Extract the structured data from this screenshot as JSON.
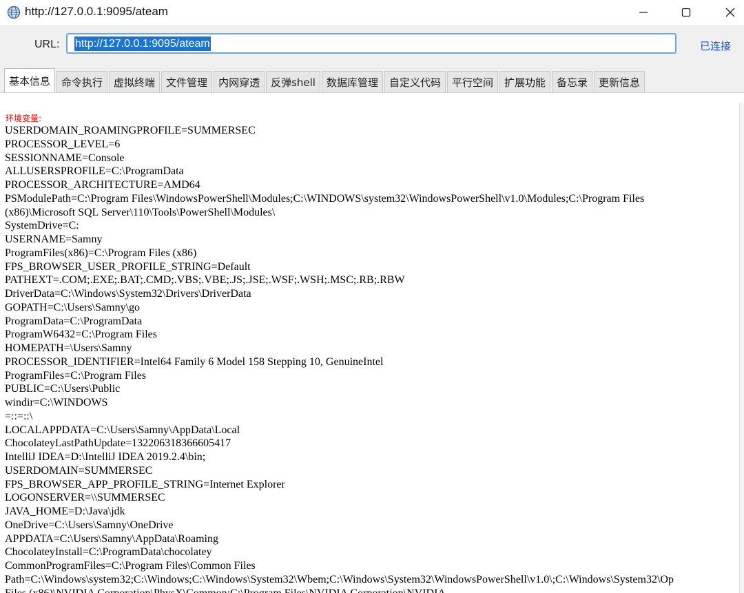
{
  "window": {
    "title": "http://127.0.0.1:9095/ateam",
    "icon": "globe-app-icon"
  },
  "toolbar": {
    "url_label": "URL:",
    "url_value": "http://127.0.0.1:9095/ateam",
    "status": "已连接",
    "status_color": "#1a56db"
  },
  "tabs": [
    {
      "label": "基本信息",
      "active": true
    },
    {
      "label": "命令执行",
      "active": false
    },
    {
      "label": "虚拟终端",
      "active": false
    },
    {
      "label": "文件管理",
      "active": false
    },
    {
      "label": "内网穿透",
      "active": false
    },
    {
      "label": "反弹shell",
      "active": false
    },
    {
      "label": "数据库管理",
      "active": false
    },
    {
      "label": "自定义代码",
      "active": false
    },
    {
      "label": "平行空间",
      "active": false
    },
    {
      "label": "扩展功能",
      "active": false
    },
    {
      "label": "备忘录",
      "active": false
    },
    {
      "label": "更新信息",
      "active": false
    }
  ],
  "content": {
    "heading": "环境变量:",
    "heading_color": "#ff0000",
    "lines": [
      "USERDOMAIN_ROAMINGPROFILE=SUMMERSEC",
      "PROCESSOR_LEVEL=6",
      "SESSIONNAME=Console",
      "ALLUSERSPROFILE=C:\\ProgramData",
      "PROCESSOR_ARCHITECTURE=AMD64",
      "PSModulePath=C:\\Program Files\\WindowsPowerShell\\Modules;C:\\WINDOWS\\system32\\WindowsPowerShell\\v1.0\\Modules;C:\\Program Files",
      "(x86)\\Microsoft SQL Server\\110\\Tools\\PowerShell\\Modules\\",
      "SystemDrive=C:",
      "USERNAME=Samny",
      "ProgramFiles(x86)=C:\\Program Files (x86)",
      "FPS_BROWSER_USER_PROFILE_STRING=Default",
      "PATHEXT=.COM;.EXE;.BAT;.CMD;.VBS;.VBE;.JS;.JSE;.WSF;.WSH;.MSC;.RB;.RBW",
      "DriverData=C:\\Windows\\System32\\Drivers\\DriverData",
      "GOPATH=C:\\Users\\Samny\\go",
      "ProgramData=C:\\ProgramData",
      "ProgramW6432=C:\\Program Files",
      "HOMEPATH=\\Users\\Samny",
      "PROCESSOR_IDENTIFIER=Intel64 Family 6 Model 158 Stepping 10, GenuineIntel",
      "ProgramFiles=C:\\Program Files",
      "PUBLIC=C:\\Users\\Public",
      "windir=C:\\WINDOWS",
      "=::=::\\",
      "LOCALAPPDATA=C:\\Users\\Samny\\AppData\\Local",
      "ChocolateyLastPathUpdate=132206318366605417",
      "IntelliJ IDEA=D:\\IntelliJ IDEA 2019.2.4\\bin;",
      "USERDOMAIN=SUMMERSEC",
      "FPS_BROWSER_APP_PROFILE_STRING=Internet Explorer",
      "LOGONSERVER=\\\\SUMMERSEC",
      "JAVA_HOME=D:\\Java\\jdk",
      "OneDrive=C:\\Users\\Samny\\OneDrive",
      "APPDATA=C:\\Users\\Samny\\AppData\\Roaming",
      "ChocolateyInstall=C:\\ProgramData\\chocolatey",
      "CommonProgramFiles=C:\\Program Files\\Common Files",
      "Path=C:\\Windows\\system32;C:\\Windows;C:\\Windows\\System32\\Wbem;C:\\Windows\\System32\\WindowsPowerShell\\v1.0\\;C:\\Windows\\System32\\Op",
      "Files (x86)\\NVIDIA Corporation\\PhysX\\Common;C:\\Program Files\\NVIDIA Corporation\\NVIDIA"
    ]
  }
}
